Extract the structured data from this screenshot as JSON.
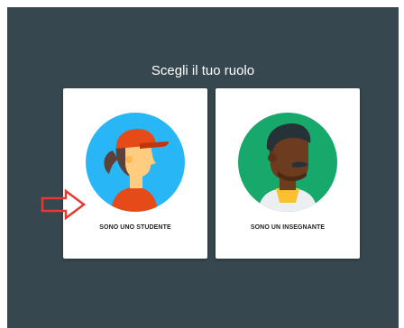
{
  "dialog": {
    "title": "Scegli il tuo ruolo"
  },
  "roles": [
    {
      "label": "SONO UNO STUDENTE",
      "icon": "student-avatar-icon",
      "circle_color": "#29b6f6"
    },
    {
      "label": "SONO UN INSEGNANTE",
      "icon": "teacher-avatar-icon",
      "circle_color": "#17a86b"
    }
  ],
  "annotation": {
    "icon": "red-arrow-icon",
    "color": "#e53935"
  },
  "colors": {
    "background": "#37474f",
    "card": "#ffffff",
    "text": "#212121"
  }
}
